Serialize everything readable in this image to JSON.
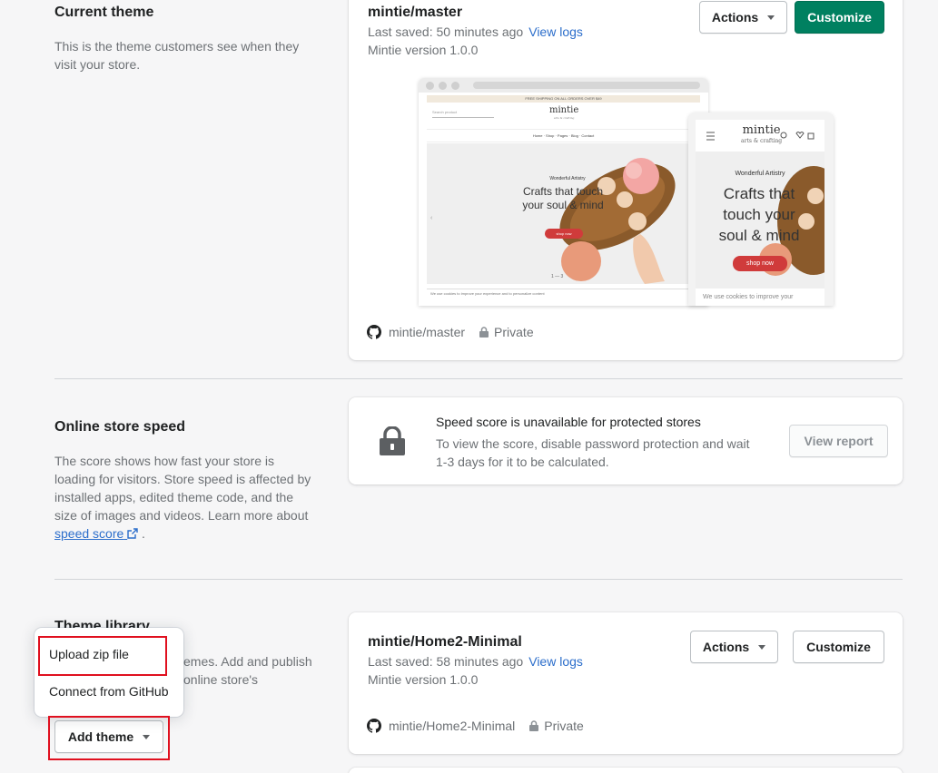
{
  "current_theme": {
    "section_title": "Current theme",
    "section_desc": "This is the theme customers see when they visit your store.",
    "name": "mintie/master",
    "last_saved": "Last saved: 50 minutes ago",
    "view_logs": "View logs",
    "version": "Mintie version 1.0.0",
    "actions_label": "Actions",
    "customize_label": "Customize",
    "repo": "mintie/master",
    "visibility": "Private",
    "preview": {
      "announcement": "FREE SHIPPING ON ALL ORDERS OVER $49",
      "search_placeholder": "Search product",
      "logo": "mintie",
      "logo_sub": "arts & crafting",
      "menu": "Home ·   Shop ·   Pages ·   Blog ·   Contact",
      "kicker": "Wonderful Artistry",
      "headline_1": "Crafts that touch",
      "headline_2": "your soul & mind",
      "shop_btn": "shop now",
      "mobile_headline_1": "Crafts that",
      "mobile_headline_2": "touch your",
      "mobile_headline_3": "soul & mind",
      "cookie": "We use cookies to improve your",
      "footer": "We use cookies to improve your experience and to personalize content"
    }
  },
  "speed": {
    "section_title": "Online store speed",
    "section_desc_prefix": "The score shows how fast your store is loading for visitors. Store speed is affected by installed apps, edited theme code, and the size of images and videos. Learn more about",
    "speed_link": "speed score",
    "card_title": "Speed score is unavailable for protected stores",
    "card_desc": "To view the score, disable password protection and wait 1-3 days for it to be calculated.",
    "view_report": "View report"
  },
  "library": {
    "section_title": "Theme library",
    "section_desc_line1": "emes. Add and publish",
    "section_desc_line2": "online store's",
    "add_theme": "Add theme",
    "menu": {
      "upload_zip": "Upload zip file",
      "connect_github": "Connect from GitHub"
    },
    "theme": {
      "name": "mintie/Home2-Minimal",
      "last_saved": "Last saved: 58 minutes ago",
      "view_logs": "View logs",
      "version": "Mintie version 1.0.0",
      "actions_label": "Actions",
      "customize_label": "Customize",
      "repo": "mintie/Home2-Minimal",
      "visibility": "Private"
    }
  },
  "colors": {
    "primary": "#008060",
    "link": "#2c6ecb",
    "highlight": "#e0101f"
  }
}
